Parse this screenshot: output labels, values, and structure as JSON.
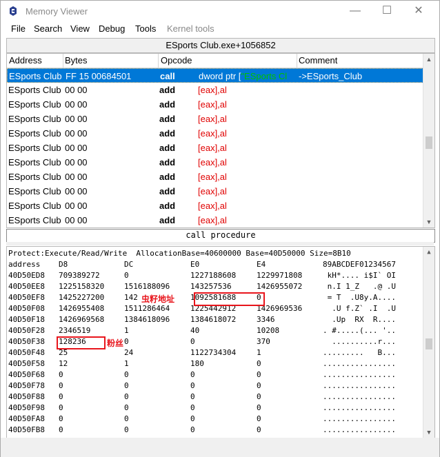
{
  "window": {
    "title": "Memory Viewer",
    "buttons": {
      "minimize": "—",
      "maximize": "☐",
      "close": "✕"
    }
  },
  "menu": [
    "File",
    "Search",
    "View",
    "Debug",
    "Tools",
    "Kernel tools"
  ],
  "address_bar": "ESports Club.exe+1056852",
  "disasm": {
    "columns": [
      "Address",
      "Bytes",
      "Opcode",
      "Comment"
    ],
    "rows": [
      {
        "address": "ESports Club",
        "bytes": "FF 15 00684501",
        "opcode": "call",
        "operand": "dword ptr [",
        "operand_green": "\"ESports Cl",
        "comment": "->ESports_Club",
        "selected": true
      },
      {
        "address": "ESports Club",
        "bytes": "00 00",
        "opcode": "add",
        "operand": "[eax],al"
      },
      {
        "address": "ESports Club",
        "bytes": "00 00",
        "opcode": "add",
        "operand": "[eax],al"
      },
      {
        "address": "ESports Club",
        "bytes": "00 00",
        "opcode": "add",
        "operand": "[eax],al"
      },
      {
        "address": "ESports Club",
        "bytes": "00 00",
        "opcode": "add",
        "operand": "[eax],al"
      },
      {
        "address": "ESports Club",
        "bytes": "00 00",
        "opcode": "add",
        "operand": "[eax],al"
      },
      {
        "address": "ESports Club",
        "bytes": "00 00",
        "opcode": "add",
        "operand": "[eax],al"
      },
      {
        "address": "ESports Club",
        "bytes": "00 00",
        "opcode": "add",
        "operand": "[eax],al"
      },
      {
        "address": "ESports Club",
        "bytes": "00 00",
        "opcode": "add",
        "operand": "[eax],al"
      },
      {
        "address": "ESports Club",
        "bytes": "00 00",
        "opcode": "add",
        "operand": "[eax],al"
      },
      {
        "address": "ESports Club",
        "bytes": "00 00",
        "opcode": "add",
        "operand": "[eax],al"
      }
    ]
  },
  "call_bar": "call procedure",
  "hex": {
    "protect_line": "Protect:Execute/Read/Write  AllocationBase=40600000 Base=40D50000 Size=8B10",
    "header": [
      "address",
      "D8",
      "DC",
      "E0",
      "E4",
      "89ABCDEF01234567"
    ],
    "rows": [
      [
        "40D50ED8",
        "709389272",
        "0",
        "1227188608",
        "1229971808",
        " kH*.... i$I` OI"
      ],
      [
        "40D50EE8",
        "1225158320",
        "1516188096",
        "143257536",
        "1426955072",
        " n.I 1_Z   .@ .U"
      ],
      [
        "40D50EF8",
        "1425227200",
        "142",
        "1092581688",
        "0",
        " = T  .U8y.A...."
      ],
      [
        "40D50F08",
        "1426955408",
        "1511286464",
        "1225442912",
        "1426969536",
        "  .U f.Z` .I  .U"
      ],
      [
        "40D50F18",
        "1426969568",
        "1384618096",
        "1384618072",
        "3346",
        "  .Up  RX  R...."
      ],
      [
        "40D50F28",
        "2346519",
        "1",
        "40",
        "10208",
        ". #.....(... '.."
      ],
      [
        "40D50F38",
        "128236",
        "0",
        "0",
        "370",
        "  ..........r..."
      ],
      [
        "40D50F48",
        "25",
        "24",
        "1122734304",
        "1",
        ".........   B..."
      ],
      [
        "40D50F58",
        "12",
        "1",
        "180",
        "0",
        "................"
      ],
      [
        "40D50F68",
        "0",
        "0",
        "0",
        "0",
        "................"
      ],
      [
        "40D50F78",
        "0",
        "0",
        "0",
        "0",
        "................"
      ],
      [
        "40D50F88",
        "0",
        "0",
        "0",
        "0",
        "................"
      ],
      [
        "40D50F98",
        "0",
        "0",
        "0",
        "0",
        "................"
      ],
      [
        "40D50FA8",
        "0",
        "0",
        "0",
        "0",
        "................"
      ],
      [
        "40D50FB8",
        "0",
        "0",
        "0",
        "0",
        "................"
      ]
    ]
  },
  "annotations": {
    "base_address": "虫籽地址",
    "fans": "粉丝"
  },
  "colors": {
    "selection": "#0078d7",
    "register": "#e00000",
    "annotation": "#e8141b",
    "green_text": "#00c000"
  }
}
